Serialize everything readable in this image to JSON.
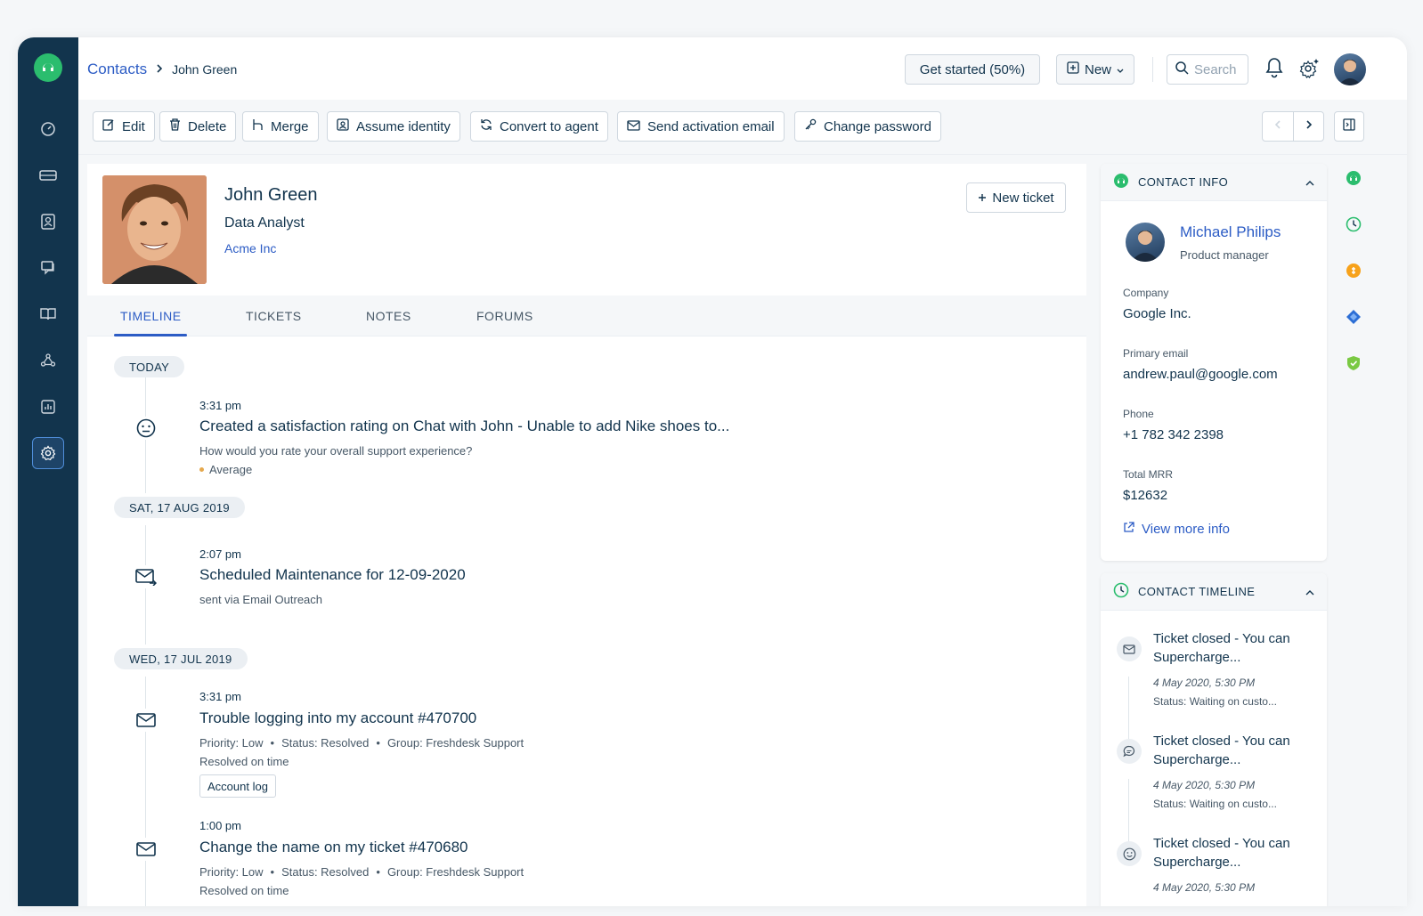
{
  "breadcrumb": {
    "parent": "Contacts",
    "current": "John Green"
  },
  "header": {
    "get_started": "Get started (50%)",
    "new_label": "New",
    "search_placeholder": "Search"
  },
  "toolbar": {
    "edit": "Edit",
    "delete": "Delete",
    "merge": "Merge",
    "assume_identity": "Assume identity",
    "convert_to_agent": "Convert to agent",
    "send_activation_email": "Send activation email",
    "change_password": "Change password"
  },
  "profile": {
    "name": "John Green",
    "title": "Data Analyst",
    "company": "Acme Inc",
    "new_ticket": "New ticket"
  },
  "tabs": [
    {
      "label": "TIMELINE"
    },
    {
      "label": "TICKETS"
    },
    {
      "label": "NOTES"
    },
    {
      "label": "FORUMS"
    }
  ],
  "timeline": {
    "groups": [
      {
        "date": "TODAY"
      },
      {
        "date": "SAT, 17 AUG 2019"
      },
      {
        "date": "WED, 17 JUL 2019"
      }
    ],
    "events": [
      {
        "time": "3:31 pm",
        "title": "Created a satisfaction rating on Chat with John - Unable to add Nike shoes to...",
        "sub": "How would you rate your overall support experience?",
        "rating": "Average",
        "icon": "smiley-icon"
      },
      {
        "time": "2:07 pm",
        "title": "Scheduled Maintenance for 12-09-2020",
        "sub": "sent via Email Outreach",
        "icon": "email-out-icon"
      },
      {
        "time": "3:31 pm",
        "title": "Trouble logging into my account #470700",
        "priority": "Priority: Low",
        "status": "Status: Resolved",
        "group": "Group: Freshdesk Support",
        "resolved": "Resolved on time",
        "account_log": "Account log",
        "icon": "email-icon"
      },
      {
        "time": "1:00 pm",
        "title": "Change the name on my ticket #470680",
        "priority": "Priority: Low",
        "status": "Status: Resolved",
        "group": "Group: Freshdesk Support",
        "resolved": "Resolved on time",
        "icon": "email-icon"
      }
    ],
    "separator": "•"
  },
  "contact_info": {
    "heading": "CONTACT INFO",
    "name": "Michael Philips",
    "role": "Product manager",
    "company_label": "Company",
    "company": "Google Inc.",
    "email_label": "Primary email",
    "email": "andrew.paul@google.com",
    "phone_label": "Phone",
    "phone": "+1 782 342 2398",
    "mrr_label": "Total MRR",
    "mrr": "$12632",
    "view_more": "View more info"
  },
  "contact_timeline": {
    "heading": "CONTACT TIMELINE",
    "items": [
      {
        "title": "Ticket closed - You can Supercharge...",
        "date": "4 May 2020, 5:30 PM",
        "status": "Status: Waiting on custo..."
      },
      {
        "title": "Ticket closed - You can Supercharge...",
        "date": "4 May 2020, 5:30 PM",
        "status": "Status: Waiting on custo..."
      },
      {
        "title": "Ticket closed - You can Supercharge...",
        "date": "4 May 2020, 5:30 PM"
      }
    ]
  },
  "colors": {
    "sidebar": "#12344d",
    "accent": "#2c5cc5",
    "brand_green": "#2bbd6e"
  }
}
